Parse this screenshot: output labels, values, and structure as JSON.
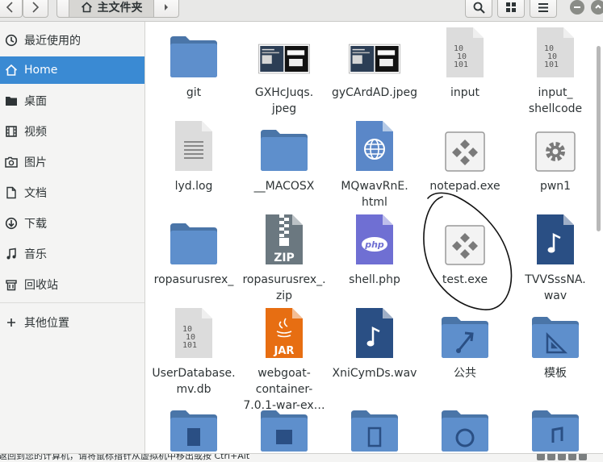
{
  "window": {
    "location": "主文件夹",
    "colors": {
      "accent": "#3a8ad3",
      "folder": "#5e8fcc",
      "folder_top": "#4a75a8",
      "media": "#2a4f84",
      "doc": "#dcdcdc"
    }
  },
  "toolbar": {
    "back_icon": "chevron-left-icon",
    "forward_icon": "chevron-right-icon",
    "home_icon": "home-icon",
    "search_icon": "search-icon",
    "view_icon": "grid-view-icon",
    "menu_icon": "hamburger-menu-icon"
  },
  "sidebar": {
    "items": [
      {
        "label": "最近使用的",
        "icon": "recent-icon"
      },
      {
        "label": "Home",
        "icon": "home-icon",
        "active": true
      },
      {
        "label": "桌面",
        "icon": "desktop-icon"
      },
      {
        "label": "视频",
        "icon": "video-icon"
      },
      {
        "label": "图片",
        "icon": "picture-icon"
      },
      {
        "label": "文档",
        "icon": "document-icon"
      },
      {
        "label": "下载",
        "icon": "download-icon"
      },
      {
        "label": "音乐",
        "icon": "music-icon"
      },
      {
        "label": "回收站",
        "icon": "trash-icon"
      },
      {
        "label": "其他位置",
        "icon": "plus-icon"
      }
    ]
  },
  "files": [
    {
      "name": "git",
      "type": "folder"
    },
    {
      "name": "GXHcJuqs.\njpeg",
      "type": "image"
    },
    {
      "name": "gyCArdAD.jpeg",
      "type": "image"
    },
    {
      "name": "input",
      "type": "binary"
    },
    {
      "name": "input_\nshellcode",
      "type": "binary"
    },
    {
      "name": "lyd.log",
      "type": "text"
    },
    {
      "name": "__MACOSX",
      "type": "folder"
    },
    {
      "name": "MQwavRnE.\nhtml",
      "type": "html"
    },
    {
      "name": "notepad.exe",
      "type": "exe"
    },
    {
      "name": "pwn1",
      "type": "gear"
    },
    {
      "name": "ropasurusrex_",
      "type": "folder"
    },
    {
      "name": "ropasurusrex_.\nzip",
      "type": "zip"
    },
    {
      "name": "shell.php",
      "type": "php"
    },
    {
      "name": "test.exe",
      "type": "exe"
    },
    {
      "name": "TVVSssNA.\nwav",
      "type": "audio"
    },
    {
      "name": "UserDatabase.\nmv.db",
      "type": "binary"
    },
    {
      "name": "webgoat-\ncontainer-\n7.0.1-war-ex…",
      "type": "jar"
    },
    {
      "name": "XniCymDs.wav",
      "type": "audio"
    },
    {
      "name": "公共",
      "type": "folder-share"
    },
    {
      "name": "模板",
      "type": "folder-template"
    },
    {
      "name": "",
      "type": "folder-video"
    },
    {
      "name": "",
      "type": "folder-pictures"
    },
    {
      "name": "",
      "type": "folder-docs"
    },
    {
      "name": "",
      "type": "folder-download"
    },
    {
      "name": "",
      "type": "folder-music"
    }
  ],
  "labels": {
    "zip_badge": "ZIP",
    "jar_badge": "JAR",
    "php_badge": "php",
    "binary_lines": [
      "10",
      "10",
      "101"
    ]
  },
  "status": {
    "message": "返回到您的计算机，请将鼠标指针从虚拟机中移出或按 Ctrl+Alt"
  }
}
